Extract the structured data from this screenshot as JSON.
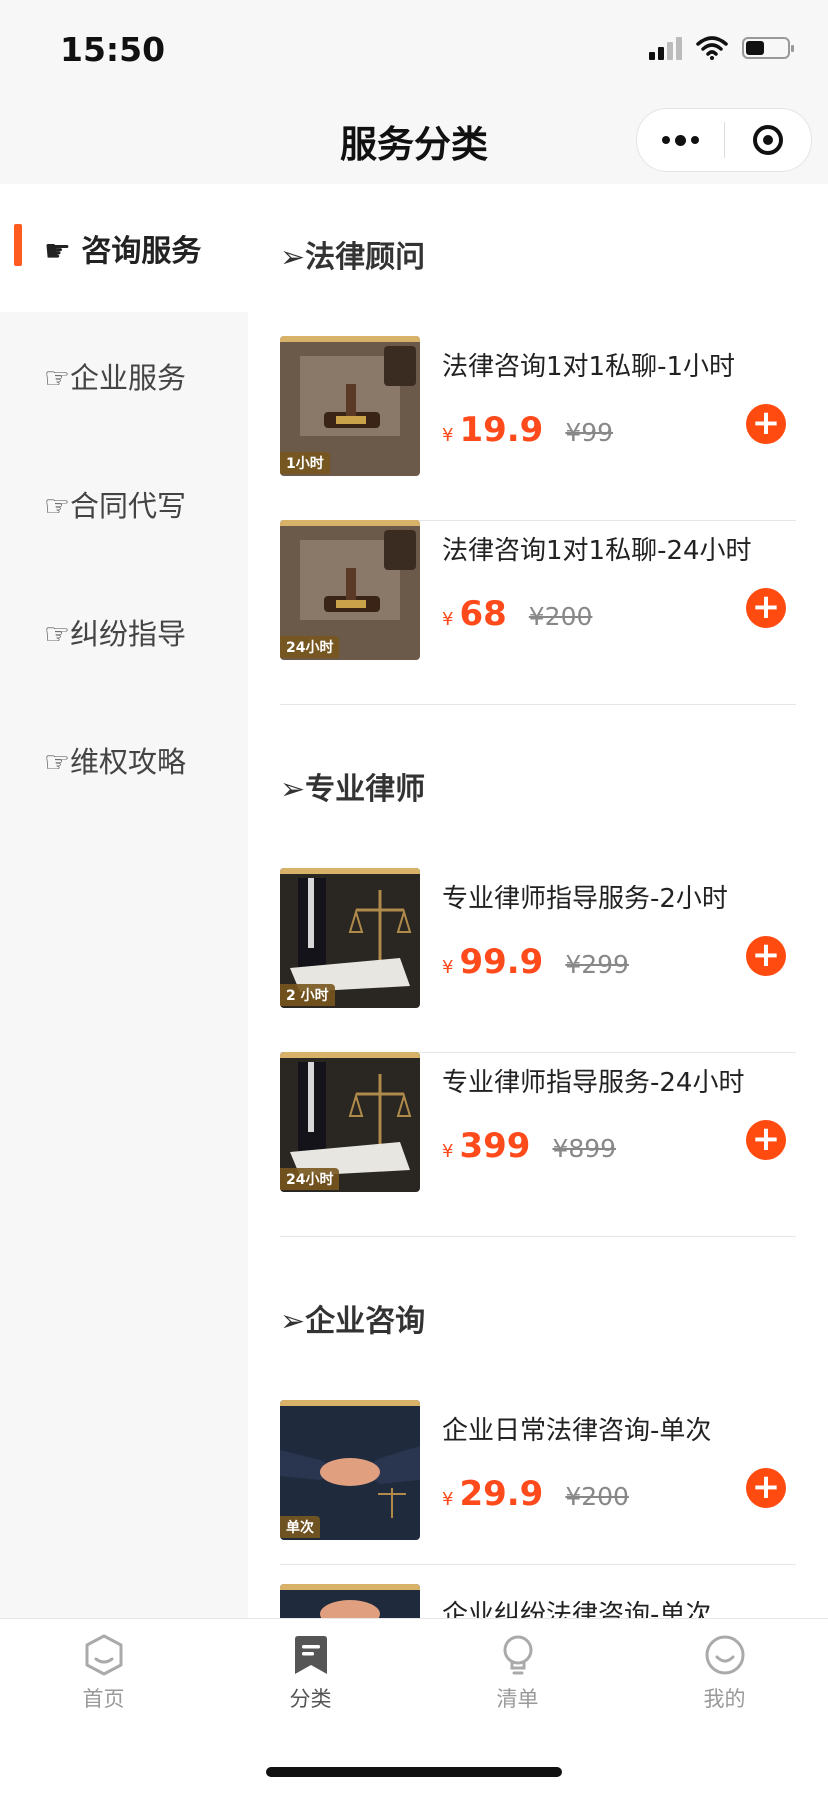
{
  "status": {
    "time": "15:50"
  },
  "nav": {
    "title": "服务分类"
  },
  "sidebar": {
    "items": [
      {
        "label": "☛ 咨询服务",
        "active": true
      },
      {
        "label": "☞企业服务",
        "active": false
      },
      {
        "label": "☞合同代写",
        "active": false
      },
      {
        "label": "☞纠纷指导",
        "active": false
      },
      {
        "label": "☞维权攻略",
        "active": false
      }
    ]
  },
  "sections": [
    {
      "title": "➢法律顾问",
      "products": [
        {
          "title": "法律咨询1对1私聊-1小时",
          "yen": "¥",
          "price": "19.9",
          "original": "¥99",
          "tag": "1小时",
          "image": "gavel-image"
        },
        {
          "title": "法律咨询1对1私聊-24小时",
          "yen": "¥",
          "price": "68",
          "original": "¥200",
          "tag": "24小时",
          "image": "gavel-image"
        }
      ]
    },
    {
      "title": "➢专业律师",
      "products": [
        {
          "title": "专业律师指导服务-2小时",
          "yen": "¥",
          "price": "99.9",
          "original": "¥299",
          "tag": "2 小时",
          "image": "scales-image"
        },
        {
          "title": "专业律师指导服务-24小时",
          "yen": "¥",
          "price": "399",
          "original": "¥899",
          "tag": "24小时",
          "image": "scales-image"
        }
      ]
    },
    {
      "title": "➢企业咨询",
      "products": [
        {
          "title": "企业日常法律咨询-单次",
          "yen": "¥",
          "price": "29.9",
          "original": "¥200",
          "tag": "单次",
          "image": "handshake-image"
        },
        {
          "title": "企业纠纷法律咨询-单次",
          "image": "handshake-image"
        }
      ]
    }
  ],
  "tabbar": {
    "tabs": [
      {
        "label": "首页",
        "icon": "home-hexagon-icon"
      },
      {
        "label": "分类",
        "icon": "category-bookmark-icon",
        "active": true
      },
      {
        "label": "清单",
        "icon": "list-bulb-icon"
      },
      {
        "label": "我的",
        "icon": "profile-smile-icon"
      }
    ]
  },
  "colors": {
    "accent": "#ff4a10",
    "price": "#ff4a1b",
    "sidebar_bg": "#f7f7f7"
  }
}
